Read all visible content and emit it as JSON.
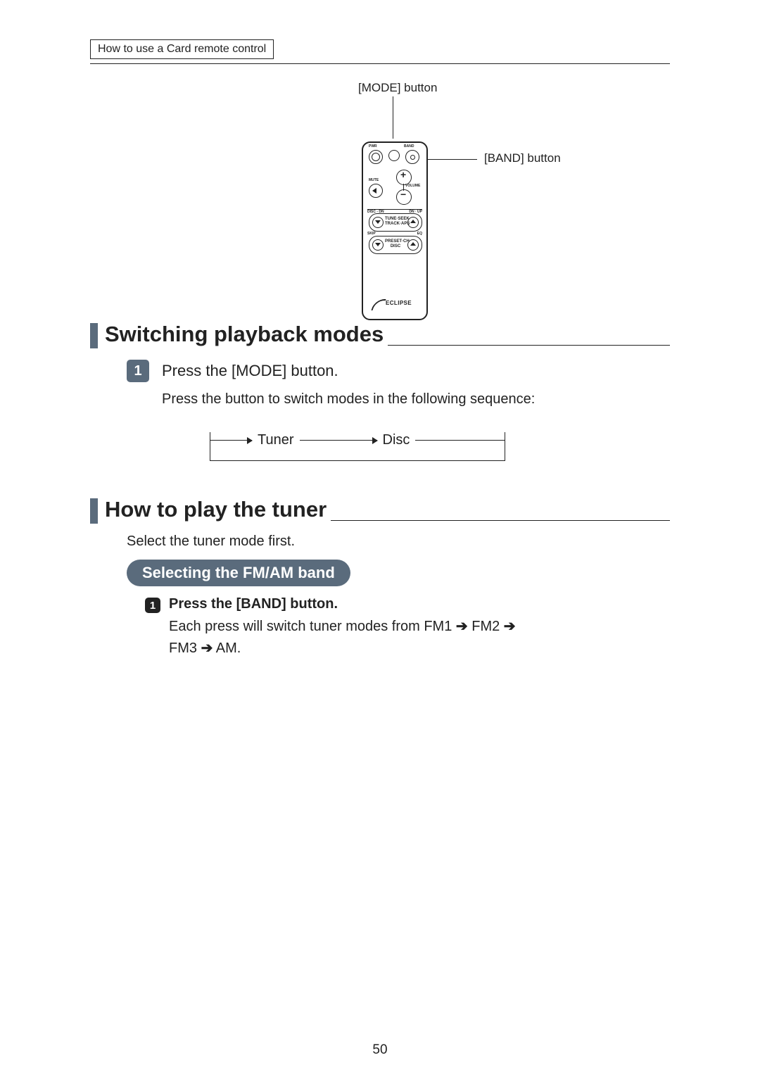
{
  "breadcrumb": "How to use a Card remote control",
  "diagram": {
    "mode_label": "[MODE] button",
    "band_label": "[BAND] button",
    "remote": {
      "pwr": "PWR",
      "band": "BAND",
      "mute": "MUTE",
      "volume": "VOLUME",
      "row1_left": "DISC - DN",
      "row1_right": "DN · UP",
      "pill1": "TUNE·SEEK\nTRACK·APS",
      "row2_left": "SKIP",
      "row2_right": "EQ",
      "pill2": "PRESET·CH\nDISC",
      "logo": "ECLIPSE"
    }
  },
  "section1": {
    "title": "Switching playback modes",
    "step_num": "1",
    "step_text": "Press the [MODE] button.",
    "body": "Press the button to switch modes in the following sequence:",
    "flow": {
      "a": "Tuner",
      "b": "Disc"
    }
  },
  "section2": {
    "title": "How to play the tuner",
    "intro": "Select the tuner mode first.",
    "pill": "Selecting the FM/AM band",
    "sub_num": "1",
    "sub_head": "Press the [BAND] button.",
    "sub_body_1": "Each press will switch tuner modes from FM1 ",
    "sub_body_2": " FM2 ",
    "sub_body_3": "FM3 ",
    "sub_body_4": " AM.",
    "arrow": "➔"
  },
  "page_number": "50"
}
